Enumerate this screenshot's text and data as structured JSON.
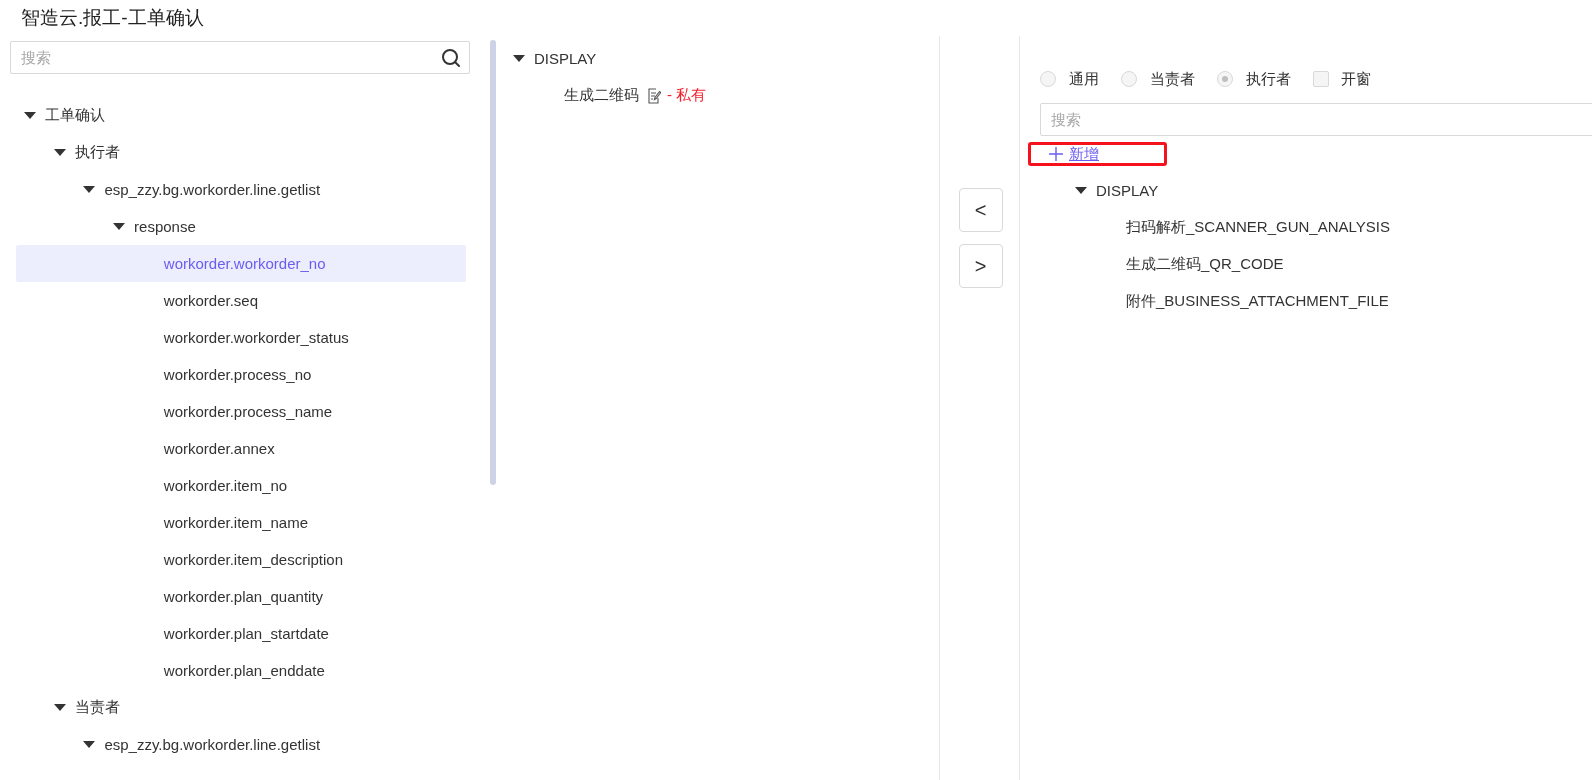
{
  "title": "智造云.报工-工单确认",
  "left_panel": {
    "search": {
      "placeholder": "搜索"
    },
    "tree": [
      {
        "label": "工单确认",
        "expanded": true,
        "selected": false,
        "children": [
          {
            "label": "执行者",
            "expanded": true,
            "selected": false,
            "children": [
              {
                "label": "esp_zzy.bg.workorder.line.getlist",
                "expanded": true,
                "selected": false,
                "children": [
                  {
                    "label": "response",
                    "expanded": true,
                    "selected": false,
                    "children": [
                      {
                        "label": "workorder.workorder_no",
                        "selected": true
                      },
                      {
                        "label": "workorder.seq",
                        "selected": false
                      },
                      {
                        "label": "workorder.workorder_status",
                        "selected": false
                      },
                      {
                        "label": "workorder.process_no",
                        "selected": false
                      },
                      {
                        "label": "workorder.process_name",
                        "selected": false
                      },
                      {
                        "label": "workorder.annex",
                        "selected": false
                      },
                      {
                        "label": "workorder.item_no",
                        "selected": false
                      },
                      {
                        "label": "workorder.item_name",
                        "selected": false
                      },
                      {
                        "label": "workorder.item_description",
                        "selected": false
                      },
                      {
                        "label": "workorder.plan_quantity",
                        "selected": false
                      },
                      {
                        "label": "workorder.plan_startdate",
                        "selected": false
                      },
                      {
                        "label": "workorder.plan_enddate",
                        "selected": false
                      }
                    ]
                  }
                ]
              }
            ]
          },
          {
            "label": "当责者",
            "expanded": true,
            "selected": false,
            "children": [
              {
                "label": "esp_zzy.bg.workorder.line.getlist",
                "expanded": true,
                "selected": false
              }
            ]
          }
        ]
      }
    ]
  },
  "middle_panel": {
    "tree": [
      {
        "label": "DISPLAY",
        "expanded": true,
        "selected": false,
        "children": [
          {
            "label": "生成二维码",
            "tag": "- 私有",
            "selected": false
          }
        ]
      }
    ]
  },
  "nav_buttons": [
    "<",
    ">"
  ],
  "right_panel": {
    "options": [
      {
        "kind": "radio",
        "label": "通用",
        "selected": false
      },
      {
        "kind": "radio",
        "label": "当责者",
        "selected": false
      },
      {
        "kind": "radio",
        "label": "执行者",
        "selected": true
      },
      {
        "kind": "checkbox",
        "label": "开窗",
        "checked": false
      }
    ],
    "search": {
      "placeholder": "搜索"
    },
    "add_link": {
      "label": "新增",
      "highlighted": true
    },
    "tree": [
      {
        "label": "DISPLAY",
        "expanded": true,
        "selected": false,
        "children": [
          {
            "label": "扫码解析_SCANNER_GUN_ANALYSIS",
            "selected": false
          },
          {
            "label": "生成二维码_QR_CODE",
            "selected": false
          },
          {
            "label": "附件_BUSINESS_ATTACHMENT_FILE",
            "selected": false
          }
        ]
      }
    ]
  }
}
